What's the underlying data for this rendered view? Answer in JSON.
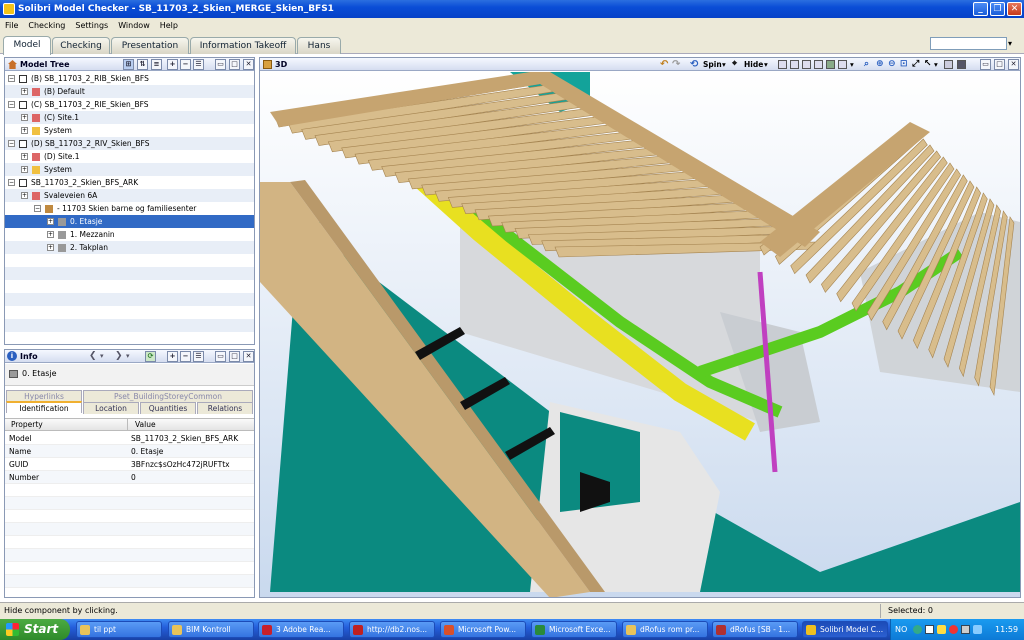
{
  "window": {
    "title": "Solibri Model Checker - SB_11703_2_Skien_MERGE_Skien_BFS1"
  },
  "menu": [
    "File",
    "Checking",
    "Settings",
    "Window",
    "Help"
  ],
  "tabs": [
    "Model",
    "Checking",
    "Presentation",
    "Information Takeoff",
    "Hans"
  ],
  "model_tree": {
    "title": "Model Tree",
    "items": [
      {
        "label": "(B) SB_11703_2_RIB_Skien_BFS",
        "indent": 0,
        "icon": "model-icon"
      },
      {
        "label": "(B) Default",
        "indent": 1,
        "icon": "site-icon"
      },
      {
        "label": "(C) SB_11703_2_RIE_Skien_BFS",
        "indent": 0,
        "icon": "model-icon"
      },
      {
        "label": "(C) Site.1",
        "indent": 1,
        "icon": "site-icon"
      },
      {
        "label": "System",
        "indent": 1,
        "icon": "folder-icon"
      },
      {
        "label": "(D) SB_11703_2_RIV_Skien_BFS",
        "indent": 0,
        "icon": "model-icon"
      },
      {
        "label": "(D) Site.1",
        "indent": 1,
        "icon": "site-icon"
      },
      {
        "label": "System",
        "indent": 1,
        "icon": "folder-icon"
      },
      {
        "label": "SB_11703_2_Skien_BFS_ARK",
        "indent": 0,
        "icon": "model-icon"
      },
      {
        "label": "Svaleveien 6A",
        "indent": 1,
        "icon": "site-icon"
      },
      {
        "label": "- 11703 Skien barne og familiesenter",
        "indent": 2,
        "icon": "building-icon"
      },
      {
        "label": "0. Etasje",
        "indent": 3,
        "icon": "storey-icon",
        "selected": true
      },
      {
        "label": "1. Mezzanin",
        "indent": 3,
        "icon": "storey-icon"
      },
      {
        "label": "2. Takplan",
        "indent": 3,
        "icon": "storey-icon"
      }
    ]
  },
  "info": {
    "title": "Info",
    "selected": "0. Etasje",
    "tabs_top": [
      "Hyperlinks",
      "Pset_BuildingStoreyCommon"
    ],
    "tabs_bottom": [
      "Identification",
      "Location",
      "Quantities",
      "Relations"
    ],
    "columns": [
      "Property",
      "Value"
    ],
    "rows": [
      {
        "property": "Model",
        "value": "SB_11703_2_Skien_BFS_ARK"
      },
      {
        "property": "Name",
        "value": "0. Etasje"
      },
      {
        "property": "GUID",
        "value": "3BFnzc$sOzHc472jRUFTtx"
      },
      {
        "property": "Number",
        "value": "0"
      }
    ]
  },
  "view3d": {
    "title": "3D",
    "spin": "Spin",
    "hide": "Hide"
  },
  "status": {
    "message": "Hide component by clicking.",
    "selected": "Selected: 0"
  },
  "taskbar": {
    "start": "Start",
    "items": [
      {
        "label": "til ppt",
        "color": "#e8c35a"
      },
      {
        "label": "BIM Kontroll",
        "color": "#e8c35a"
      },
      {
        "label": "3 Adobe Rea...",
        "color": "#c8202a"
      },
      {
        "label": "http://db2.nos...",
        "color": "#c02020"
      },
      {
        "label": "Microsoft Pow...",
        "color": "#d9502a"
      },
      {
        "label": "Microsoft Exce...",
        "color": "#2a8a3a"
      },
      {
        "label": "dRofus rom pr...",
        "color": "#e8c35a"
      },
      {
        "label": "dRofus [SB - 1...",
        "color": "#b03030"
      },
      {
        "label": "Solibri Model C...",
        "color": "#f0c020",
        "active": true
      }
    ],
    "lang": "NO",
    "time": "11:59"
  }
}
